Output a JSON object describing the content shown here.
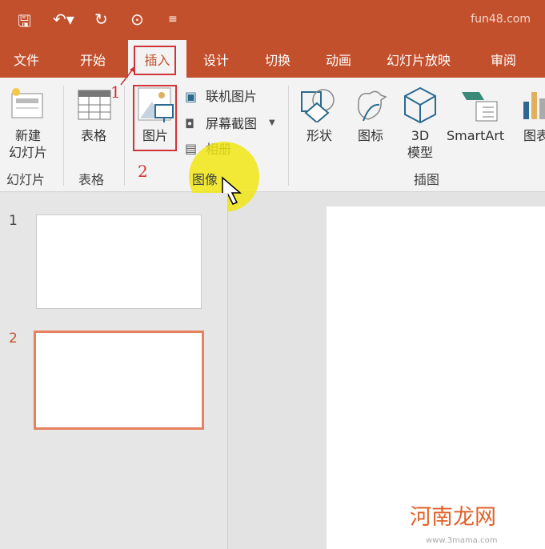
{
  "titlebar": {
    "site": "fun48.com",
    "icons": [
      "save-icon",
      "undo-icon",
      "redo-icon",
      "present-icon",
      "customize-icon"
    ]
  },
  "tabs": [
    "文件",
    "开始",
    "插入",
    "设计",
    "切换",
    "动画",
    "幻灯片放映",
    "审阅"
  ],
  "active_tab": "插入",
  "ribbon": {
    "new_slide": "新建\n幻灯片",
    "table": "表格",
    "picture": "图片",
    "online_picture": "联机图片",
    "screenshot": "屏幕截图",
    "album": "相册",
    "shapes": "形状",
    "icons": "图标",
    "model3d_a": "3D",
    "model3d_b": "模型",
    "smartart": "SmartArt",
    "chart": "图表",
    "groups": {
      "slides": "幻灯片",
      "tables": "表格",
      "images": "图像",
      "illustrations": "插图"
    }
  },
  "annotations": {
    "step1": "1",
    "step2": "2"
  },
  "slides_panel": {
    "numbers": [
      "1",
      "2"
    ],
    "selected": 2
  },
  "watermark": {
    "text": "河南龙网",
    "url": "www.3mama.com"
  },
  "colors": {
    "accent": "#c3502c",
    "highlight": "#d13438",
    "selected_thumb": "#e6805f"
  }
}
